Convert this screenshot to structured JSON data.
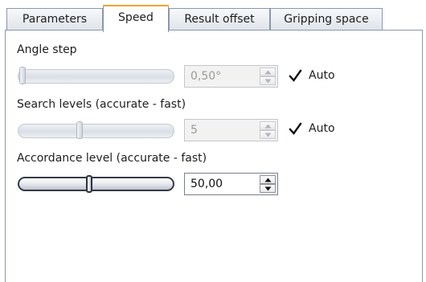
{
  "tabs": [
    {
      "label": "Parameters",
      "active": false
    },
    {
      "label": "Speed",
      "active": true
    },
    {
      "label": "Result offset",
      "active": false
    },
    {
      "label": "Gripping space",
      "active": false
    }
  ],
  "colors": {
    "active_tab_accent": "#f1a532",
    "border": "#8a97aa",
    "disabled_text": "#9a9a9a"
  },
  "angle_step": {
    "label": "Angle step",
    "slider_value_fraction": 0.0,
    "value": "0,50°",
    "enabled": false,
    "auto_label": "Auto",
    "auto_checked": true
  },
  "search_levels": {
    "label": "Search levels (accurate - fast)",
    "slider_value_fraction": 0.45,
    "value": "5",
    "enabled": false,
    "auto_label": "Auto",
    "auto_checked": true
  },
  "accordance_level": {
    "label": "Accordance level (accurate - fast)",
    "slider_value_fraction": 0.5,
    "value": "50,00",
    "enabled": true
  }
}
